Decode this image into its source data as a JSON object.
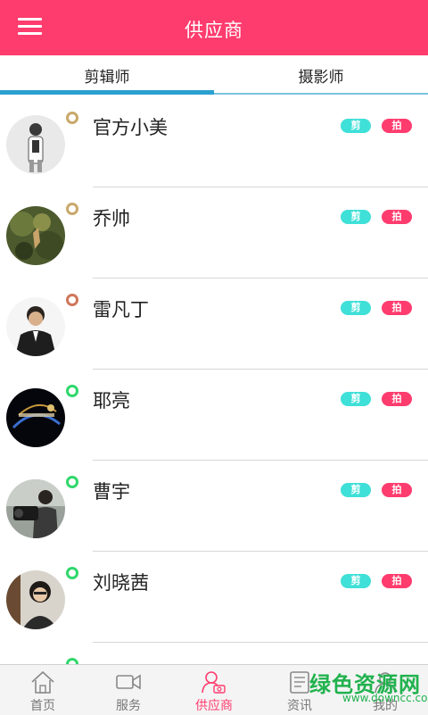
{
  "header": {
    "title": "供应商"
  },
  "tabs": [
    {
      "label": "剪辑师"
    },
    {
      "label": "摄影师"
    }
  ],
  "badges": {
    "cut": "剪",
    "shoot": "拍"
  },
  "colors": {
    "brand": "#ff3c6e",
    "tab_accent": "#2aa1d0",
    "cut_badge": "#3fe0d8",
    "online": "#2fd86b",
    "offline": "#c9a86a"
  },
  "suppliers": [
    {
      "name": "官方小美"
    },
    {
      "name": "乔帅"
    },
    {
      "name": "雷凡丁"
    },
    {
      "name": "耶亮"
    },
    {
      "name": "曹宇"
    },
    {
      "name": "刘晓茜"
    }
  ],
  "bottom_nav": [
    {
      "label": "首页",
      "icon": "home-icon"
    },
    {
      "label": "服务",
      "icon": "video-camera-icon"
    },
    {
      "label": "供应商",
      "icon": "supplier-icon"
    },
    {
      "label": "资讯",
      "icon": "news-icon"
    },
    {
      "label": "我的",
      "icon": "user-icon"
    }
  ],
  "watermark": {
    "text": "绿色资源网",
    "url": "www.downcc.com"
  }
}
